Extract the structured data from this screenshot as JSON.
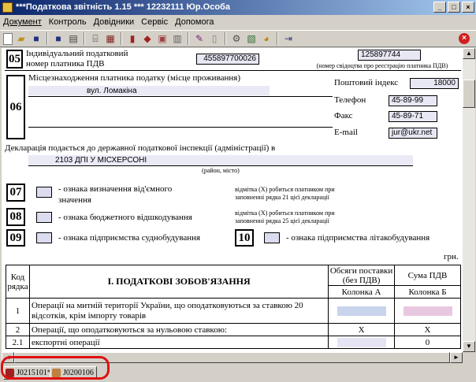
{
  "window": {
    "title": "***Податкова звітність 1.15 *** 12232111 Юр.Особа",
    "min": "_",
    "max": "□",
    "close": "×"
  },
  "menu": [
    "Документ",
    "Контроль",
    "Довідники",
    "Сервіс",
    "Допомога"
  ],
  "toolbar": {
    "buttons": [
      "new-icon",
      "open-icon",
      "save-icon",
      "save-all-icon",
      "print-icon",
      "preview-icon",
      "export-icon",
      "book-icon",
      "library-icon",
      "copy-icon",
      "paste-icon",
      "wizard-icon",
      "page-icon",
      "settings-icon",
      "layout-icon",
      "check-icon",
      "exit-icon"
    ],
    "close_icon": "close-circle-icon"
  },
  "form": {
    "s05": {
      "num": "05",
      "label_l1": "Індивідуальний податковий",
      "label_l2": "номер платника ПДВ",
      "ipn": "455897700026",
      "cert_no": "125897744",
      "cert_caption": "(номер свідоцтва про реєстрацію платника ПДВ)"
    },
    "s06": {
      "num": "06",
      "label": "Місцезнаходження платника податку (місце проживання)",
      "address": "вул. Ломакіна",
      "postcode_label": "Поштовий індекс",
      "postcode": "18000",
      "phone_label": "Телефон",
      "phone": "45-89-99",
      "fax_label": "Факс",
      "fax": "45-89-71",
      "email_label": "E-mail",
      "email": "jur@ukr.net"
    },
    "inspection": {
      "label": "Декларація подається до державної податкової інспекції (адміністрації) в",
      "value": "2103 ДПІ У МІСХЕРСОНІ",
      "caption": "(район, місто)"
    },
    "s07": {
      "num": "07",
      "label_l1": "- ознака визначення від'ємного",
      "label_l2": "значення",
      "note_l1": "відмітка (Х) робиться платником при",
      "note_l2": "заповненні рядка 21 цієї декларації"
    },
    "s08": {
      "num": "08",
      "label": "- ознака бюджетного відшкодування",
      "note_l1": "відмітка (Х) робиться платником при",
      "note_l2": "заповненні рядка 25 цієї декларації"
    },
    "s09": {
      "num": "09",
      "label": "- ознака підприємства суднобудування"
    },
    "s10": {
      "num": "10",
      "label": "- ознака підприємства літакобудування"
    },
    "currency": "грн."
  },
  "table": {
    "h_code_l1": "Код",
    "h_code_l2": "рядка",
    "h_section": "I. ПОДАТКОВІ ЗОБОВ'ЯЗАННЯ",
    "h_a_l1": "Обсяги поставки",
    "h_a_l2": "(без ПДВ)",
    "h_b": "Сума ПДВ",
    "col_a": "Колонка А",
    "col_b": "Колонка Б",
    "rows": [
      {
        "code": "1",
        "text_l1": "Операції на митній території України, що оподатковуються за ставкою 20",
        "text_l2": "відсотків, крім імпорту товарів",
        "a": "",
        "b": ""
      },
      {
        "code": "2",
        "text": "Операції, що оподатковуються за нульовою ставкою:",
        "a": "X",
        "b": "X"
      },
      {
        "code": "2.1",
        "text": "експортні операції",
        "a": "",
        "b": "0"
      }
    ]
  },
  "tabs": [
    {
      "label": "J0215101*"
    },
    {
      "label": "J0200106"
    }
  ]
}
